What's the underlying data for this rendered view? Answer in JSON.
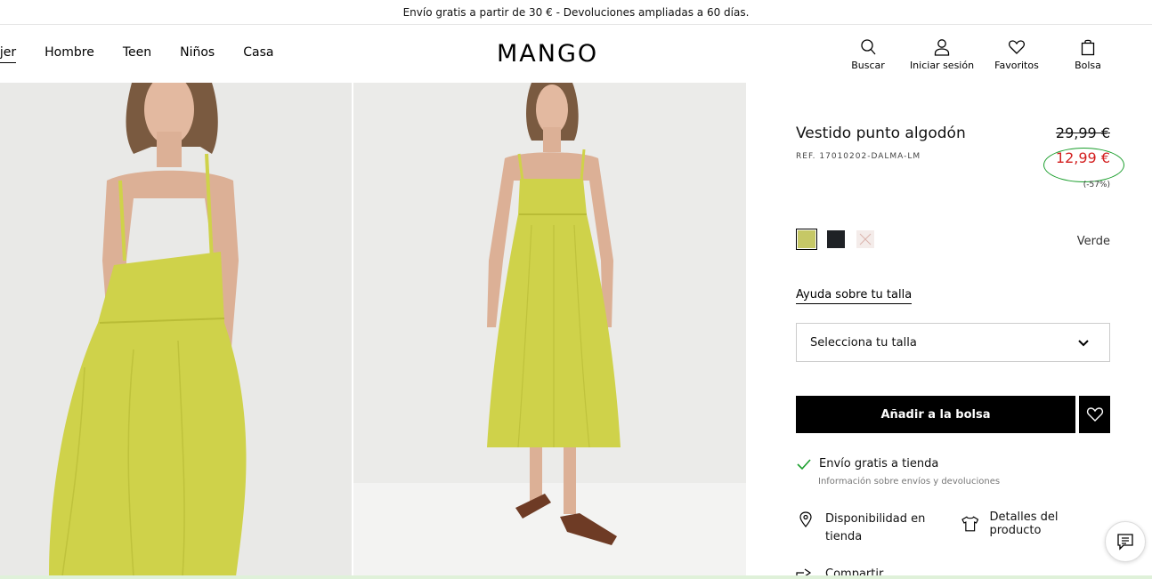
{
  "promo": {
    "text": "Envío gratis a partir de 30 € - Devoluciones ampliadas a 60 días."
  },
  "nav": {
    "items": [
      "ujer",
      "Hombre",
      "Teen",
      "Niños",
      "Casa"
    ]
  },
  "logo": "MANGO",
  "header_actions": {
    "search": "Buscar",
    "login": "Iniciar sesión",
    "favorites": "Favoritos",
    "bag": "Bolsa"
  },
  "product": {
    "name": "Vestido punto algodón",
    "ref": "REF. 17010202-DALMA-LM",
    "old_price": "29,99 €",
    "new_price": "12,99 €",
    "discount": "(-57%)",
    "color_name": "Verde",
    "swatches": [
      "#c6c866",
      "#1f2226",
      "#f4ecea"
    ],
    "size_help": "Ayuda sobre tu talla",
    "size_placeholder": "Selecciona tu talla",
    "add_to_bag": "Añadir a la bolsa",
    "shipping": "Envío gratis a tienda",
    "shipping_info": "Información sobre envíos y devoluciones",
    "availability": "Disponibilidad en tienda",
    "details": "Detalles del producto",
    "share": "Compartir"
  },
  "colors": {
    "price_sale": "#d31f1f",
    "highlight_circle": "#1a9e2c",
    "dress": "#cfd24a"
  }
}
